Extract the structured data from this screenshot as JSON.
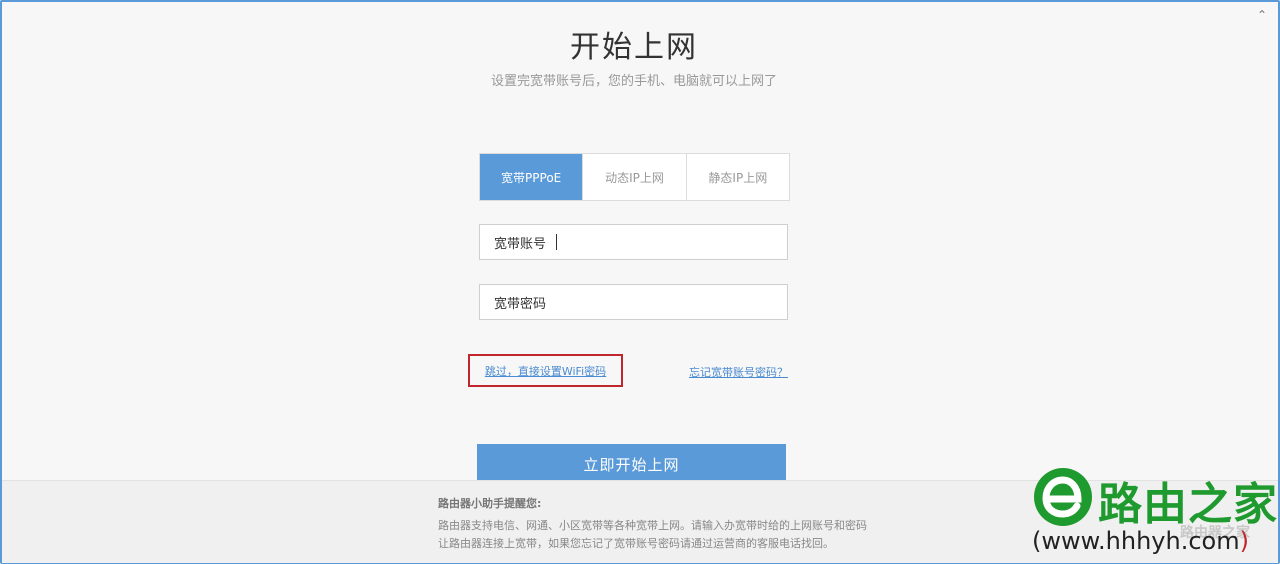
{
  "header": {
    "title": "开始上网",
    "subtitle": "设置完宽带账号后，您的手机、电脑就可以上网了"
  },
  "tabs": [
    {
      "label": "宽带PPPoE",
      "active": true
    },
    {
      "label": "动态IP上网",
      "active": false
    },
    {
      "label": "静态IP上网",
      "active": false
    }
  ],
  "form": {
    "account_label": "宽带账号",
    "password_label": "宽带密码"
  },
  "links": {
    "skip": "跳过，直接设置WiFi密码",
    "forgot": "忘记宽带账号密码？"
  },
  "start_button": "立即开始上网",
  "tips": {
    "title": "路由器小助手提醒您:",
    "line1": "路由器支持电信、网通、小区宽带等各种宽带上网。请输入办宽带时给的上网账号和密码",
    "line2": "让路由器连接上宽带，如果您忘记了宽带账号密码请通过运营商的客服电话找回。"
  },
  "watermark": {
    "name": "路由之家",
    "url_prefix": "(www.hhhyh.com",
    "url_suffix": ")",
    "faint": "路由器之家"
  },
  "colors": {
    "accent": "#5b9ad8",
    "highlight": "#c0272d",
    "brand_green": "#1f9a2f"
  },
  "icons": {
    "scroll_up": "chevron-up-icon",
    "logo": "e-logo-icon"
  }
}
